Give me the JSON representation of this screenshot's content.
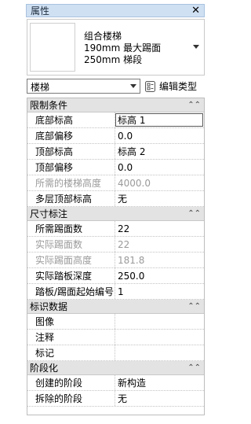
{
  "panel": {
    "title": "属性",
    "close_glyph": "✕"
  },
  "type_selector": {
    "lines": [
      "组合楼梯",
      "190mm 最大踢面",
      "250mm 梯段"
    ]
  },
  "family_dropdown": {
    "value": "楼梯"
  },
  "edit_type": {
    "label": "编辑类型"
  },
  "groups": [
    {
      "label": "限制条件",
      "rows": [
        {
          "name": "底部标高",
          "value": "标高 1"
        },
        {
          "name": "底部偏移",
          "value": "0.0"
        },
        {
          "name": "顶部标高",
          "value": "标高 2"
        },
        {
          "name": "顶部偏移",
          "value": "0.0"
        },
        {
          "name": "所需的楼梯高度",
          "value": "4000.0"
        },
        {
          "name": "多层顶部标高",
          "value": "无"
        }
      ]
    },
    {
      "label": "尺寸标注",
      "rows": [
        {
          "name": "所需踢面数",
          "value": "22"
        },
        {
          "name": "实际踢面数",
          "value": "22"
        },
        {
          "name": "实际踢面高度",
          "value": "181.8"
        },
        {
          "name": "实际踏板深度",
          "value": "250.0"
        },
        {
          "name": "踏板/踢面起始编号",
          "value": "1"
        }
      ]
    },
    {
      "label": "标识数据",
      "rows": [
        {
          "name": "图像",
          "value": ""
        },
        {
          "name": "注释",
          "value": ""
        },
        {
          "name": "标记",
          "value": ""
        }
      ]
    },
    {
      "label": "阶段化",
      "rows": [
        {
          "name": "创建的阶段",
          "value": "新构造"
        },
        {
          "name": "拆除的阶段",
          "value": "无"
        }
      ]
    }
  ]
}
